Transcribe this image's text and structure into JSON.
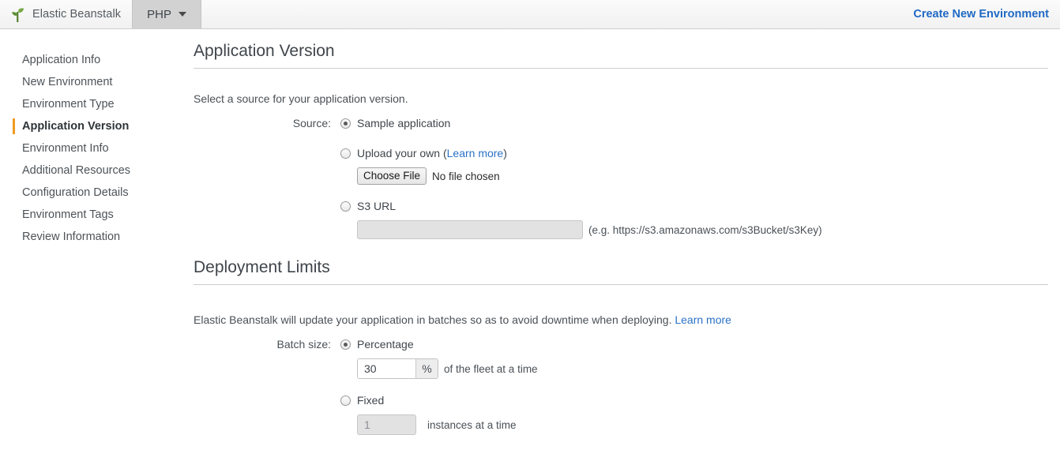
{
  "header": {
    "logo_icon": "beanstalk-sprout-icon",
    "brand": "Elastic Beanstalk",
    "platform_tab": {
      "label": "PHP",
      "caret_icon": "chevron-down-icon"
    },
    "create_environment_link": "Create New Environment",
    "link_color": "#1f69c4"
  },
  "sidebar": {
    "active_marker_color": "#ef9b21",
    "items": [
      {
        "label": "Application Info",
        "active": false
      },
      {
        "label": "New Environment",
        "active": false
      },
      {
        "label": "Environment Type",
        "active": false
      },
      {
        "label": "Application Version",
        "active": true
      },
      {
        "label": "Environment Info",
        "active": false
      },
      {
        "label": "Additional Resources",
        "active": false
      },
      {
        "label": "Configuration Details",
        "active": false
      },
      {
        "label": "Environment Tags",
        "active": false
      },
      {
        "label": "Review Information",
        "active": false
      }
    ]
  },
  "application_version": {
    "title": "Application Version",
    "lead": "Select a source for your application version.",
    "source_label": "Source:",
    "options": {
      "sample": {
        "label": "Sample application",
        "selected": true
      },
      "upload": {
        "label": "Upload your own (",
        "learn_more": "Learn more",
        "label_close": ")",
        "selected": false,
        "file_button": "Choose File",
        "file_status": "No file chosen"
      },
      "s3": {
        "label": "S3 URL",
        "selected": false,
        "value": "",
        "hint": "(e.g. https://s3.amazonaws.com/s3Bucket/s3Key)"
      }
    }
  },
  "deployment_limits": {
    "title": "Deployment Limits",
    "lead": "Elastic Beanstalk will update your application in batches so as to avoid downtime when deploying.",
    "learn_more": "Learn more",
    "batch_size_label": "Batch size:",
    "options": {
      "percentage": {
        "label": "Percentage",
        "selected": true,
        "value": "30",
        "addon": "%",
        "suffix": "of the fleet at a time"
      },
      "fixed": {
        "label": "Fixed",
        "selected": false,
        "value": "1",
        "suffix": "instances at a time"
      }
    }
  }
}
